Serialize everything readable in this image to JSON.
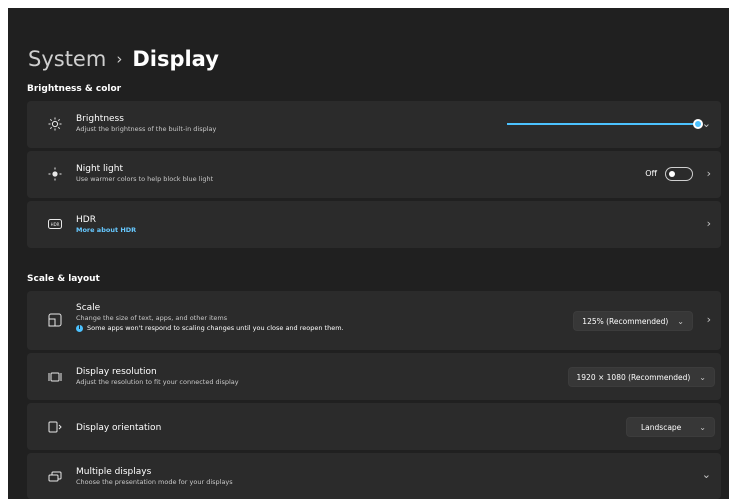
{
  "header": {
    "parent": "System",
    "separator": "›",
    "current": "Display"
  },
  "sections": {
    "brightness_color": "Brightness & color",
    "scale_layout": "Scale & layout"
  },
  "brightness": {
    "title": "Brightness",
    "subtitle": "Adjust the brightness of the built-in display",
    "level_percent": 100
  },
  "night_light": {
    "title": "Night light",
    "subtitle": "Use warmer colors to help block blue light",
    "state": "Off"
  },
  "hdr": {
    "title": "HDR",
    "link": "More about HDR"
  },
  "scale": {
    "title": "Scale",
    "subtitle": "Change the size of text, apps, and other items",
    "warning": "Some apps won't respond to scaling changes until you close and reopen them.",
    "value": "125% (Recommended)"
  },
  "resolution": {
    "title": "Display resolution",
    "subtitle": "Adjust the resolution to fit your connected display",
    "value": "1920 × 1080 (Recommended)"
  },
  "orientation": {
    "title": "Display orientation",
    "value": "Landscape"
  },
  "multiple_displays": {
    "title": "Multiple displays",
    "subtitle": "Choose the presentation mode for your displays"
  },
  "colors": {
    "accent": "#4cc2ff",
    "background": "#202020",
    "card": "#2b2b2b"
  }
}
